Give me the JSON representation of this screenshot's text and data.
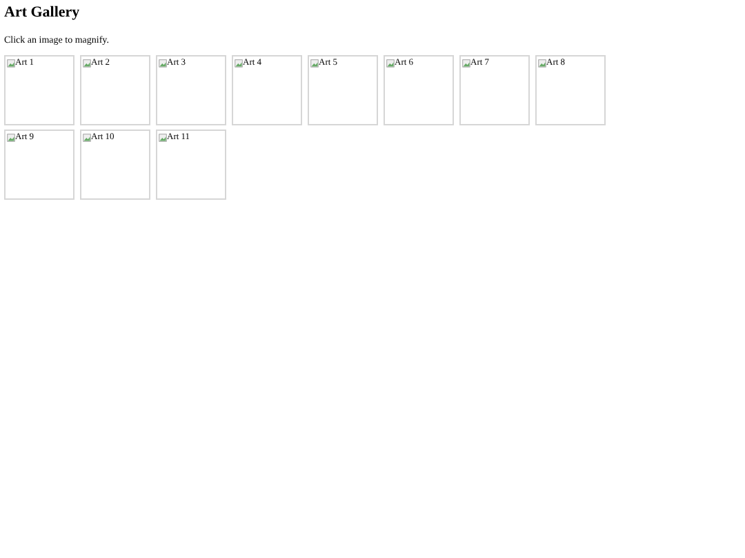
{
  "heading": "Art Gallery",
  "instruction": "Click an image to magnify.",
  "images": [
    {
      "alt": "Art 1"
    },
    {
      "alt": "Art 2"
    },
    {
      "alt": "Art 3"
    },
    {
      "alt": "Art 4"
    },
    {
      "alt": "Art 5"
    },
    {
      "alt": "Art 6"
    },
    {
      "alt": "Art 7"
    },
    {
      "alt": "Art 8"
    },
    {
      "alt": "Art 9"
    },
    {
      "alt": "Art 10"
    },
    {
      "alt": "Art 11"
    }
  ]
}
